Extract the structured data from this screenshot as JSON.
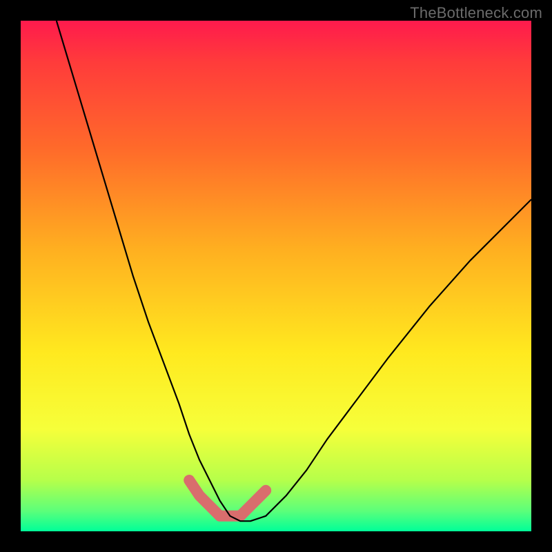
{
  "watermark": "TheBottleneck.com",
  "chart_data": {
    "type": "line",
    "title": "",
    "xlabel": "",
    "ylabel": "",
    "xlim": [
      0,
      1
    ],
    "ylim": [
      0,
      1
    ],
    "grid": false,
    "legend": false,
    "series": [
      {
        "name": "bottleneck-curve",
        "x": [
          0.07,
          0.1,
          0.13,
          0.16,
          0.19,
          0.22,
          0.25,
          0.28,
          0.31,
          0.33,
          0.35,
          0.37,
          0.39,
          0.41,
          0.43,
          0.45,
          0.48,
          0.52,
          0.56,
          0.6,
          0.66,
          0.72,
          0.8,
          0.88,
          0.96,
          1.0
        ],
        "y": [
          1.0,
          0.9,
          0.8,
          0.7,
          0.6,
          0.5,
          0.41,
          0.33,
          0.25,
          0.19,
          0.14,
          0.1,
          0.06,
          0.03,
          0.02,
          0.02,
          0.03,
          0.07,
          0.12,
          0.18,
          0.26,
          0.34,
          0.44,
          0.53,
          0.61,
          0.65
        ],
        "stroke": "#000000",
        "stroke_width": 2.2
      },
      {
        "name": "valley-highlight",
        "x": [
          0.33,
          0.35,
          0.37,
          0.39,
          0.41,
          0.43,
          0.45,
          0.48
        ],
        "y": [
          0.1,
          0.07,
          0.05,
          0.03,
          0.03,
          0.03,
          0.05,
          0.08
        ],
        "stroke": "#d96d6d",
        "stroke_width": 16,
        "linecap": "round"
      }
    ]
  }
}
